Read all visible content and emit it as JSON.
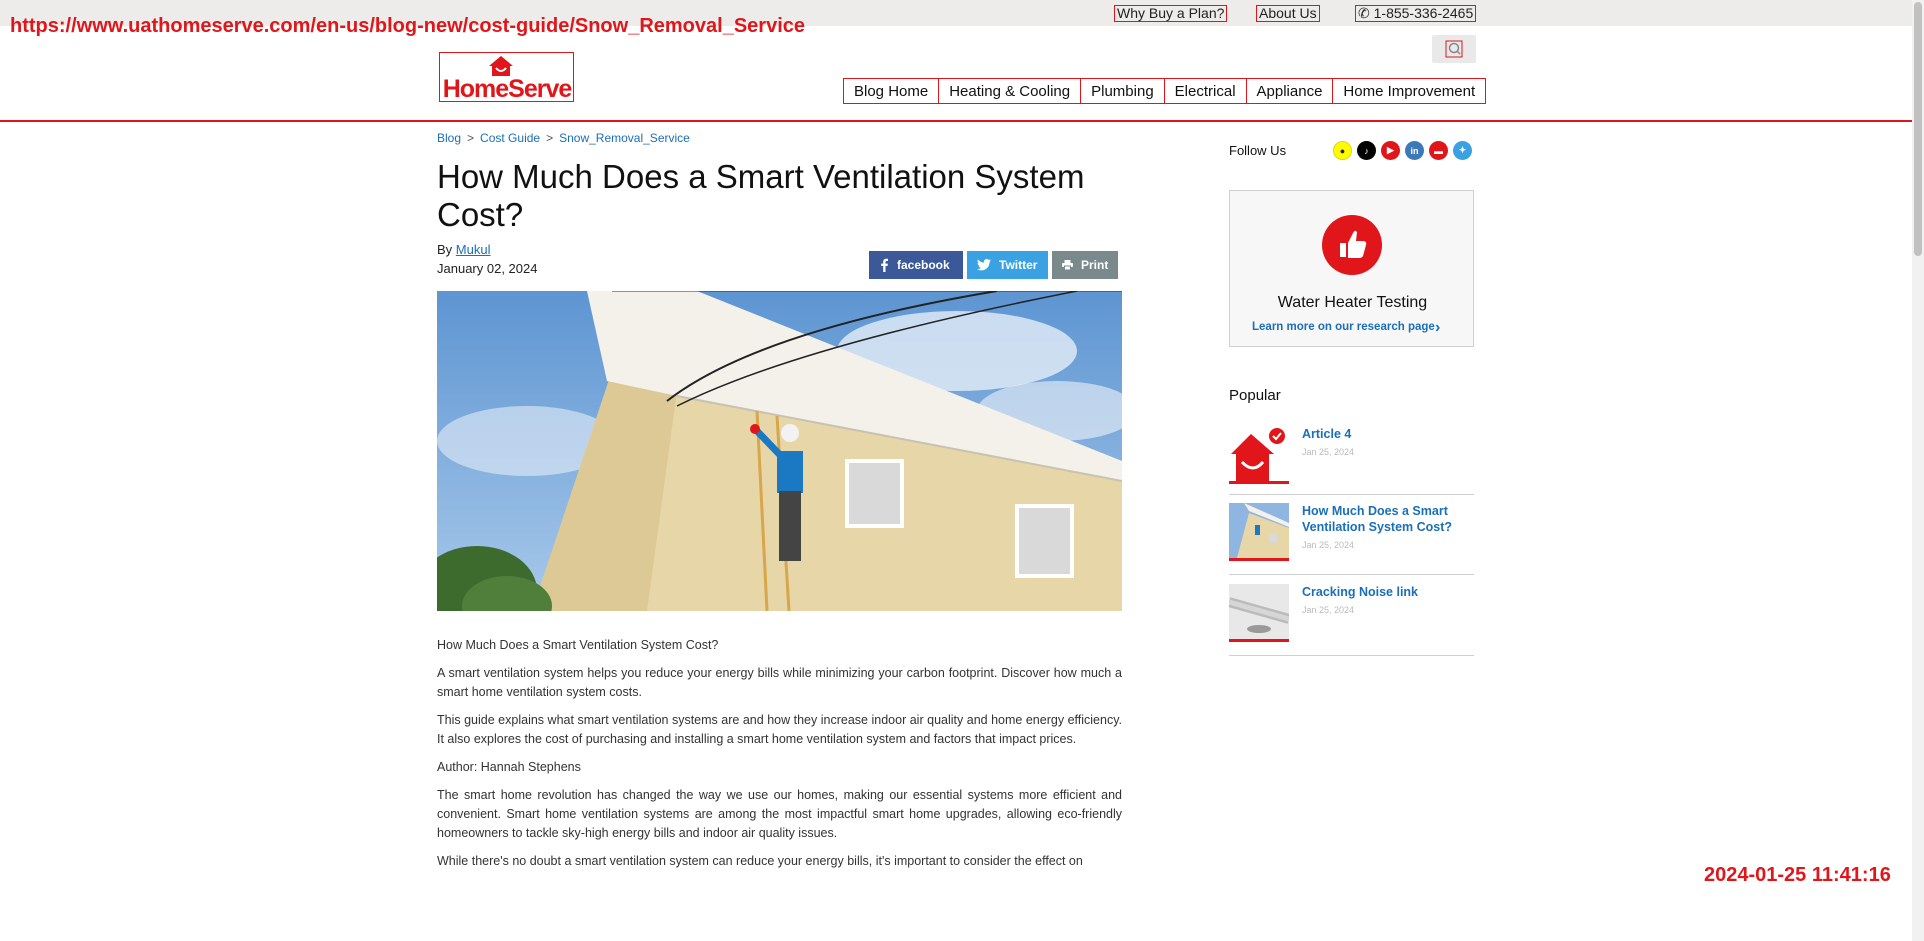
{
  "overlay": {
    "url": "https://www.uathomeserve.com/en-us/blog-new/cost-guide/Snow_Removal_Service",
    "timestamp": "2024-01-25 11:41:16"
  },
  "utility_nav": {
    "why_buy": "Why Buy a Plan?",
    "about": "About Us",
    "phone": "1-855-336-2465"
  },
  "logo": {
    "text": "HomeServe"
  },
  "main_nav": [
    {
      "label": "Blog Home"
    },
    {
      "label": "Heating & Cooling"
    },
    {
      "label": "Plumbing"
    },
    {
      "label": "Electrical"
    },
    {
      "label": "Appliance"
    },
    {
      "label": "Home Improvement"
    }
  ],
  "breadcrumb": [
    "Blog",
    "Cost Guide",
    "Snow_Removal_Service"
  ],
  "article": {
    "title": "How Much Does a Smart Ventilation System Cost?",
    "by_label": "By",
    "author": "Mukul",
    "date": "January 02, 2024",
    "share": {
      "facebook": "facebook",
      "twitter": "Twitter",
      "print": "Print"
    },
    "paragraphs": [
      "How Much Does a Smart Ventilation System Cost?",
      "A smart ventilation system helps you reduce your energy bills while minimizing your carbon footprint. Discover how much a smart home ventilation system costs.",
      "This guide explains what smart ventilation systems are and how they increase indoor air quality and home energy efficiency. It also explores the cost of purchasing and installing a smart home ventilation system and factors that impact prices.",
      "Author: Hannah Stephens",
      "The smart home revolution has changed the way we use our homes, making our essential systems more efficient and convenient. Smart home ventilation systems are among the most impactful smart home upgrades, allowing eco-friendly homeowners to tackle sky-high energy bills and indoor air quality issues.",
      "While there's no doubt a smart ventilation system can reduce your energy bills, it's important to consider the effect on"
    ]
  },
  "sidebar": {
    "follow_label": "Follow Us",
    "social": [
      {
        "icon": "snapchat-icon",
        "color": "#fffc00"
      },
      {
        "icon": "tiktok-icon",
        "color": "#000000"
      },
      {
        "icon": "youtube-icon",
        "color": "#e0161b"
      },
      {
        "icon": "linkedin-icon",
        "color": "#3d79b8"
      },
      {
        "icon": "truck-icon",
        "color": "#e0161b"
      },
      {
        "icon": "twitter-icon",
        "color": "#3aa1e3"
      }
    ],
    "promo": {
      "title": "Water Heater Testing",
      "link": "Learn more on our research page"
    },
    "popular_heading": "Popular",
    "popular": [
      {
        "title": "Article 4",
        "date": "Jan 25, 2024"
      },
      {
        "title": "How Much Does a Smart Ventilation System Cost?",
        "date": "Jan 25, 2024"
      },
      {
        "title": "Cracking Noise link",
        "date": "Jan 25, 2024"
      }
    ]
  },
  "colors": {
    "brand": "#e0161b",
    "link": "#1a6fb8",
    "facebook": "#3b5998",
    "twitter": "#3aa1e3",
    "print": "#7a8a8c"
  }
}
